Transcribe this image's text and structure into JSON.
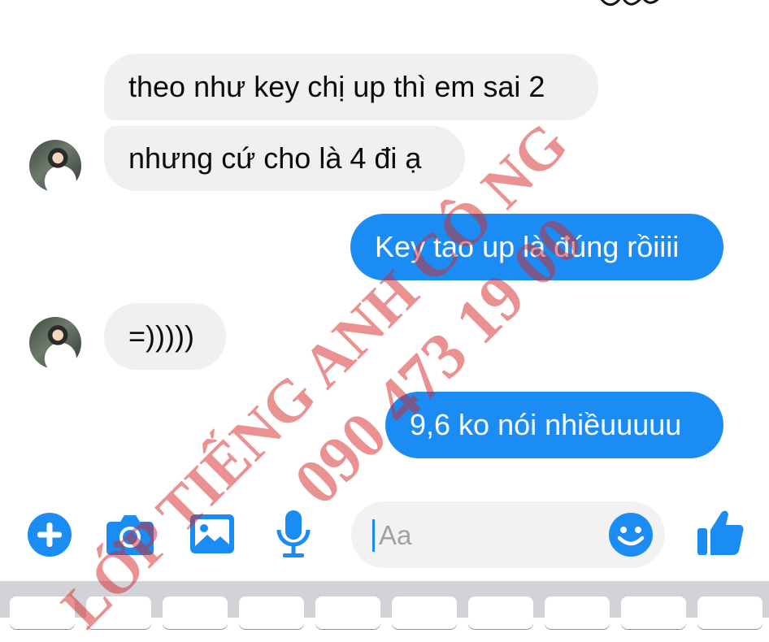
{
  "messages": [
    {
      "side": "in",
      "text": "theo như key chị up thì em sai 2"
    },
    {
      "side": "in",
      "text": "nhưng cứ cho là 4 đi ạ"
    },
    {
      "side": "out",
      "text": "Key tao up là đúng rồiiii"
    },
    {
      "side": "in",
      "text": "=)))))"
    },
    {
      "side": "out",
      "text": "9,6 ko nói nhiềuuuuu"
    }
  ],
  "composer": {
    "placeholder": "Aa",
    "icons": [
      "plus-icon",
      "camera-icon",
      "image-icon",
      "microphone-icon",
      "emoji-icon",
      "thumbs-up-icon"
    ]
  },
  "watermark": {
    "line1": "LỚP TIẾNG ANH CÔ NG",
    "line2": "090 473 19 00"
  },
  "colors": {
    "outgoing_bubble": "#1a8cf3",
    "incoming_bubble": "#f0f0f1",
    "accent": "#1a8cf3",
    "watermark": "#d62626"
  }
}
